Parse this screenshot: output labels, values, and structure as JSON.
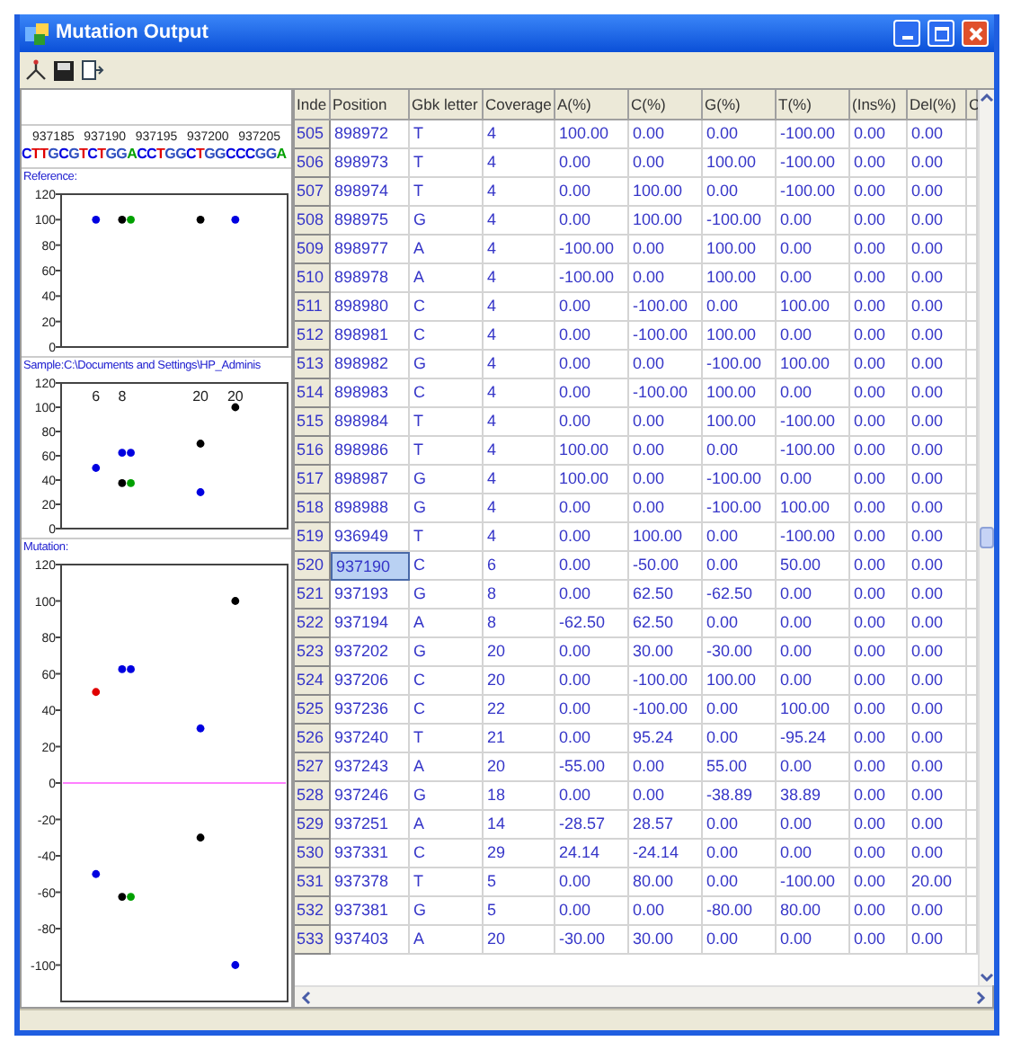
{
  "window": {
    "title": "Mutation Output"
  },
  "sequence_view": {
    "ruler": [
      "937185",
      "937190",
      "937195",
      "937200",
      "937205"
    ],
    "sequence": "CTTGCGTCTGGACCTGGCTGGCCCGGA"
  },
  "charts": [
    {
      "kind": "reference",
      "label": "Reference:",
      "y_labels": [
        "120",
        "100",
        "80",
        "60",
        "40",
        "20",
        "0"
      ]
    },
    {
      "kind": "sample",
      "label": "Sample:C:\\Documents and Settings\\HP_Adminis",
      "y_labels": [
        "120",
        "100",
        "80",
        "60",
        "40",
        "20",
        "0"
      ],
      "coverage_labels": [
        "6",
        "8",
        "20",
        "20"
      ]
    },
    {
      "kind": "mutation",
      "label": "Mutation:",
      "y_labels": [
        "120",
        "100",
        "80",
        "60",
        "40",
        "20",
        "0",
        "-20",
        "-40",
        "-60",
        "-80",
        "-100"
      ]
    }
  ],
  "table": {
    "columns": [
      "Inde",
      "Position",
      "Gbk letter",
      "Coverage",
      "A(%)",
      "C(%)",
      "G(%)",
      "T(%)",
      "(Ins%)",
      "Del(%)",
      "C"
    ],
    "rows": [
      {
        "cells": [
          "505",
          "898972",
          "T",
          "4",
          "100.00",
          "0.00",
          "0.00",
          "-100.00",
          "0.00",
          "0.00"
        ],
        "selected": false
      },
      {
        "cells": [
          "506",
          "898973",
          "T",
          "4",
          "0.00",
          "0.00",
          "100.00",
          "-100.00",
          "0.00",
          "0.00"
        ],
        "selected": false
      },
      {
        "cells": [
          "507",
          "898974",
          "T",
          "4",
          "0.00",
          "100.00",
          "0.00",
          "-100.00",
          "0.00",
          "0.00"
        ],
        "selected": false
      },
      {
        "cells": [
          "508",
          "898975",
          "G",
          "4",
          "0.00",
          "100.00",
          "-100.00",
          "0.00",
          "0.00",
          "0.00"
        ],
        "selected": false
      },
      {
        "cells": [
          "509",
          "898977",
          "A",
          "4",
          "-100.00",
          "0.00",
          "100.00",
          "0.00",
          "0.00",
          "0.00"
        ],
        "selected": false
      },
      {
        "cells": [
          "510",
          "898978",
          "A",
          "4",
          "-100.00",
          "0.00",
          "100.00",
          "0.00",
          "0.00",
          "0.00"
        ],
        "selected": false
      },
      {
        "cells": [
          "511",
          "898980",
          "C",
          "4",
          "0.00",
          "-100.00",
          "0.00",
          "100.00",
          "0.00",
          "0.00"
        ],
        "selected": false
      },
      {
        "cells": [
          "512",
          "898981",
          "C",
          "4",
          "0.00",
          "-100.00",
          "100.00",
          "0.00",
          "0.00",
          "0.00"
        ],
        "selected": false
      },
      {
        "cells": [
          "513",
          "898982",
          "G",
          "4",
          "0.00",
          "0.00",
          "-100.00",
          "100.00",
          "0.00",
          "0.00"
        ],
        "selected": false
      },
      {
        "cells": [
          "514",
          "898983",
          "C",
          "4",
          "0.00",
          "-100.00",
          "100.00",
          "0.00",
          "0.00",
          "0.00"
        ],
        "selected": false
      },
      {
        "cells": [
          "515",
          "898984",
          "T",
          "4",
          "0.00",
          "0.00",
          "100.00",
          "-100.00",
          "0.00",
          "0.00"
        ],
        "selected": false
      },
      {
        "cells": [
          "516",
          "898986",
          "T",
          "4",
          "100.00",
          "0.00",
          "0.00",
          "-100.00",
          "0.00",
          "0.00"
        ],
        "selected": false
      },
      {
        "cells": [
          "517",
          "898987",
          "G",
          "4",
          "100.00",
          "0.00",
          "-100.00",
          "0.00",
          "0.00",
          "0.00"
        ],
        "selected": false
      },
      {
        "cells": [
          "518",
          "898988",
          "G",
          "4",
          "0.00",
          "0.00",
          "-100.00",
          "100.00",
          "0.00",
          "0.00"
        ],
        "selected": false
      },
      {
        "cells": [
          "519",
          "936949",
          "T",
          "4",
          "0.00",
          "100.00",
          "0.00",
          "-100.00",
          "0.00",
          "0.00"
        ],
        "selected": false
      },
      {
        "cells": [
          "520",
          "937190",
          "C",
          "6",
          "0.00",
          "-50.00",
          "0.00",
          "50.00",
          "0.00",
          "0.00"
        ],
        "selected": true
      },
      {
        "cells": [
          "521",
          "937193",
          "G",
          "8",
          "0.00",
          "62.50",
          "-62.50",
          "0.00",
          "0.00",
          "0.00"
        ],
        "selected": false
      },
      {
        "cells": [
          "522",
          "937194",
          "A",
          "8",
          "-62.50",
          "62.50",
          "0.00",
          "0.00",
          "0.00",
          "0.00"
        ],
        "selected": false
      },
      {
        "cells": [
          "523",
          "937202",
          "G",
          "20",
          "0.00",
          "30.00",
          "-30.00",
          "0.00",
          "0.00",
          "0.00"
        ],
        "selected": false
      },
      {
        "cells": [
          "524",
          "937206",
          "C",
          "20",
          "0.00",
          "-100.00",
          "100.00",
          "0.00",
          "0.00",
          "0.00"
        ],
        "selected": false
      },
      {
        "cells": [
          "525",
          "937236",
          "C",
          "22",
          "0.00",
          "-100.00",
          "0.00",
          "100.00",
          "0.00",
          "0.00"
        ],
        "selected": false
      },
      {
        "cells": [
          "526",
          "937240",
          "T",
          "21",
          "0.00",
          "95.24",
          "0.00",
          "-95.24",
          "0.00",
          "0.00"
        ],
        "selected": false
      },
      {
        "cells": [
          "527",
          "937243",
          "A",
          "20",
          "-55.00",
          "0.00",
          "55.00",
          "0.00",
          "0.00",
          "0.00"
        ],
        "selected": false
      },
      {
        "cells": [
          "528",
          "937246",
          "G",
          "18",
          "0.00",
          "0.00",
          "-38.89",
          "38.89",
          "0.00",
          "0.00"
        ],
        "selected": false
      },
      {
        "cells": [
          "529",
          "937251",
          "A",
          "14",
          "-28.57",
          "28.57",
          "0.00",
          "0.00",
          "0.00",
          "0.00"
        ],
        "selected": false
      },
      {
        "cells": [
          "530",
          "937331",
          "C",
          "29",
          "24.14",
          "-24.14",
          "0.00",
          "0.00",
          "0.00",
          "0.00"
        ],
        "selected": false
      },
      {
        "cells": [
          "531",
          "937378",
          "T",
          "5",
          "0.00",
          "80.00",
          "0.00",
          "-100.00",
          "0.00",
          "20.00"
        ],
        "selected": false
      },
      {
        "cells": [
          "532",
          "937381",
          "G",
          "5",
          "0.00",
          "0.00",
          "-80.00",
          "80.00",
          "0.00",
          "0.00"
        ],
        "selected": false
      },
      {
        "cells": [
          "533",
          "937403",
          "A",
          "20",
          "-30.00",
          "30.00",
          "0.00",
          "0.00",
          "0.00",
          "0.00"
        ],
        "selected": false
      }
    ]
  }
}
